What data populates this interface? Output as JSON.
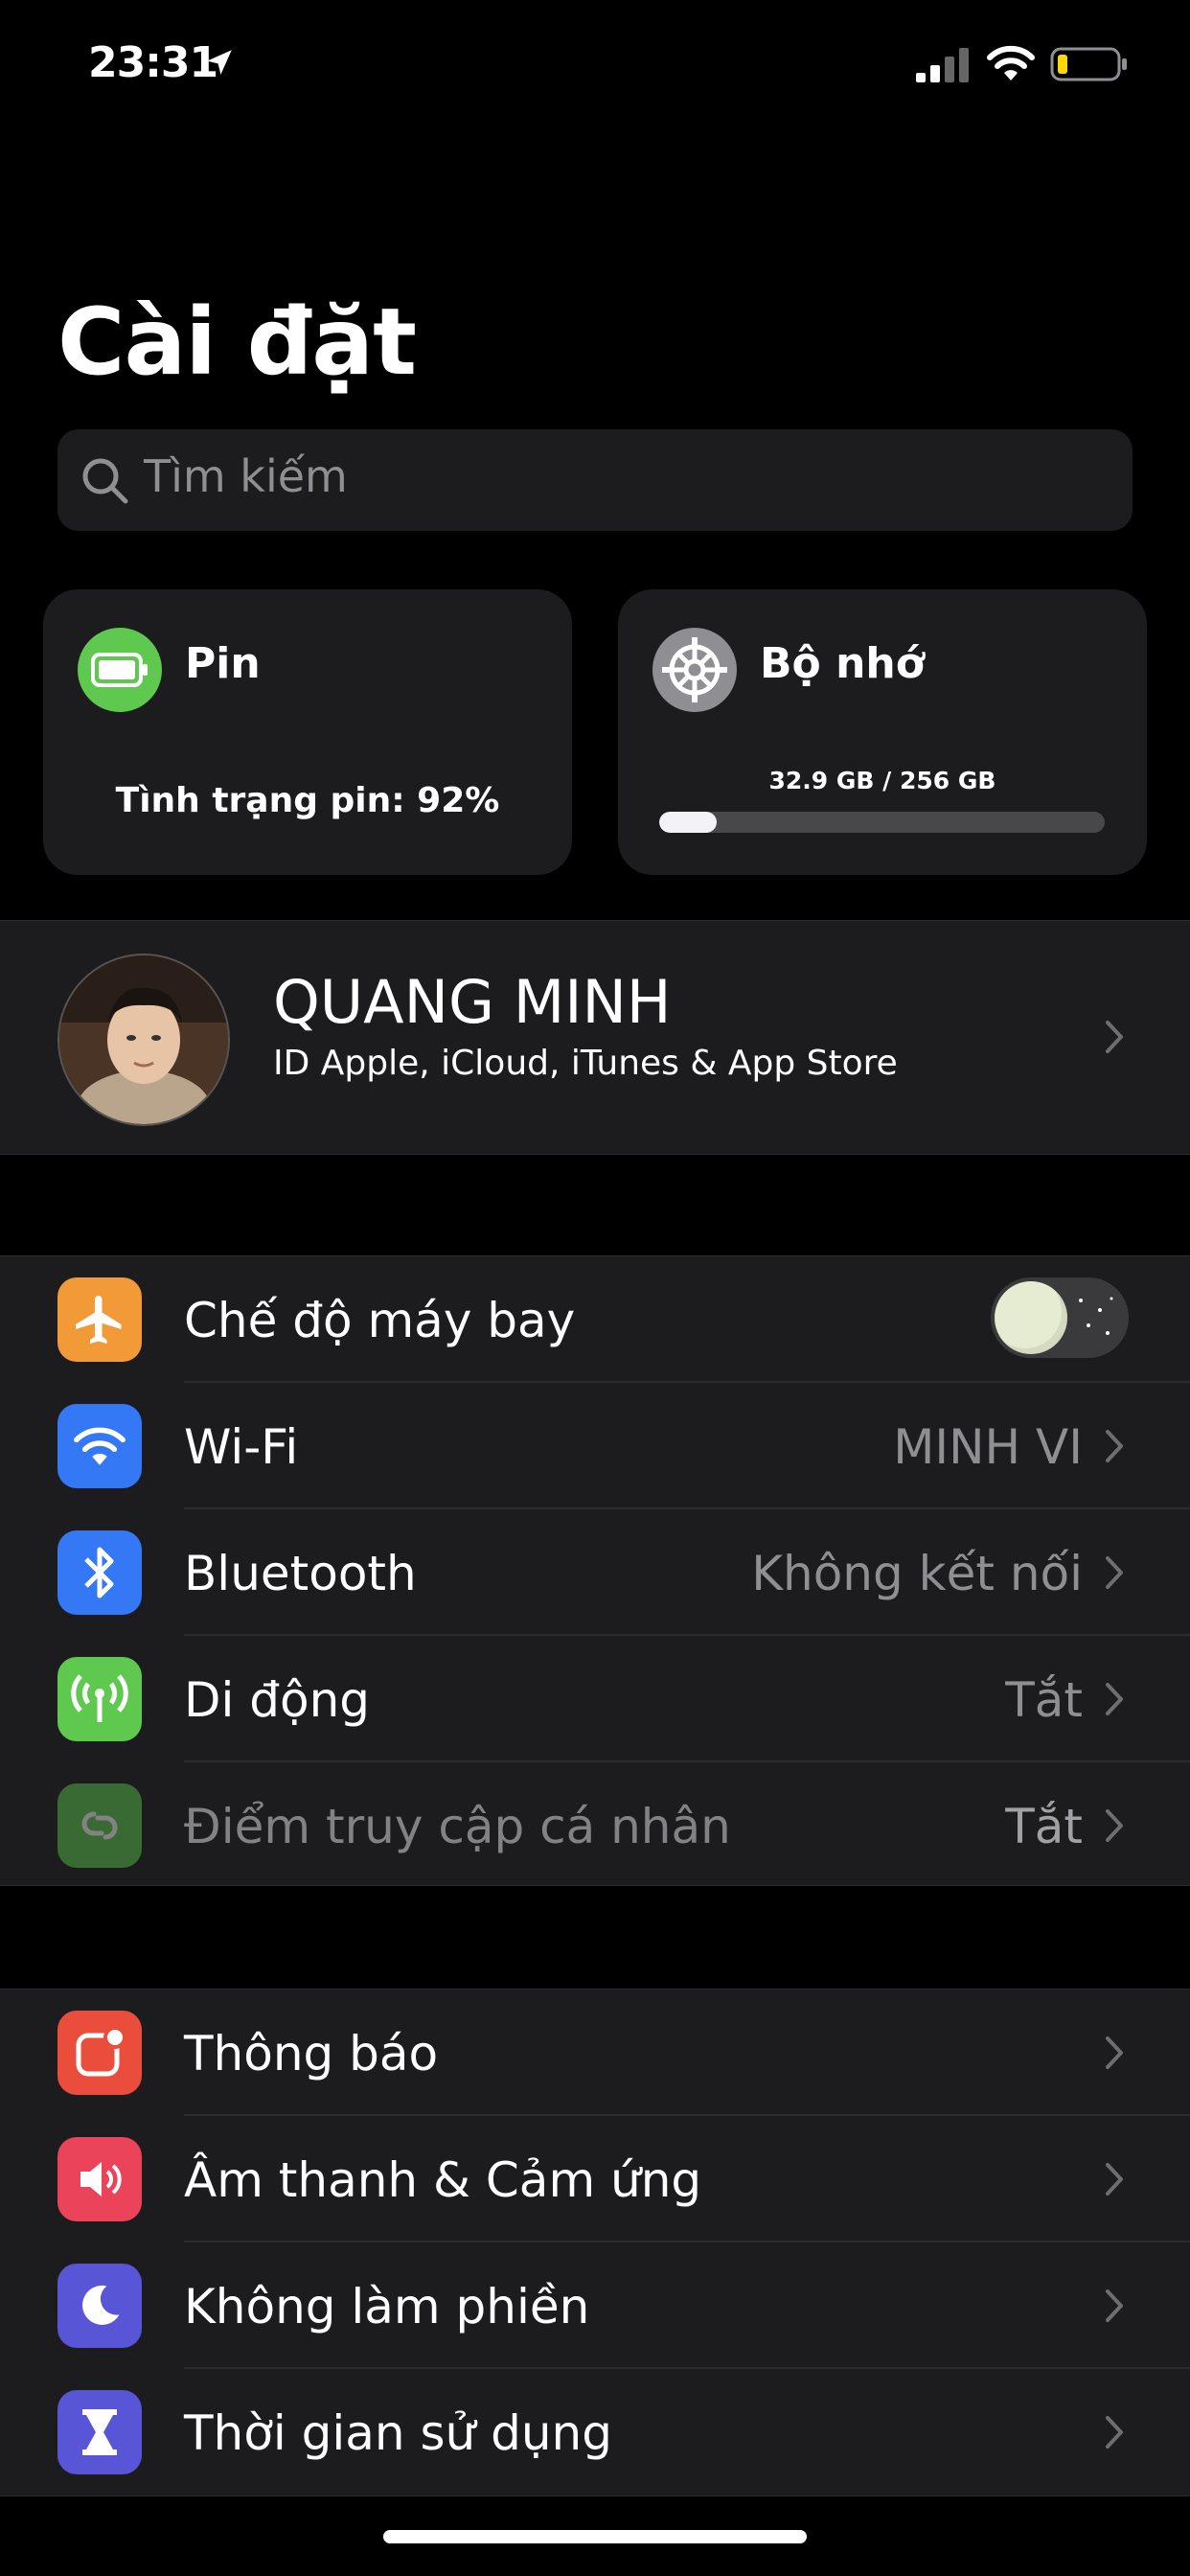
{
  "status_bar": {
    "time": "23:31",
    "icons": [
      "location-arrow-icon",
      "cellular-signal-icon",
      "wifi-icon",
      "battery-low-icon"
    ]
  },
  "header": {
    "title": "Cài đặt"
  },
  "search": {
    "placeholder": "Tìm kiếm",
    "icon": "search-icon"
  },
  "widgets": {
    "battery": {
      "title": "Pin",
      "health_text": "Tình trạng pin: 92%",
      "accent": "#5fc94f"
    },
    "storage": {
      "title": "Bộ nhớ",
      "usage_text": "32.9 GB / 256 GB",
      "used_fraction": 0.1285
    }
  },
  "profile": {
    "name": "QUANG MINH",
    "subtitle": "ID Apple, iCloud, iTunes & App Store"
  },
  "sections": [
    {
      "rows": [
        {
          "label": "Chế độ máy bay",
          "icon": "airplane-icon",
          "color": "#f19a37",
          "control": "toggle",
          "toggle_on": false
        },
        {
          "label": "Wi-Fi",
          "icon": "wifi-icon",
          "color": "#3478f6",
          "value": "MINH VI"
        },
        {
          "label": "Bluetooth",
          "icon": "bluetooth-icon",
          "color": "#3478f6",
          "value": "Không kết nối"
        },
        {
          "label": "Di động",
          "icon": "antenna-icon",
          "color": "#5fc94f",
          "value": "Tắt"
        },
        {
          "label": "Điểm truy cập cá nhân",
          "icon": "hotspot-icon",
          "color": "#5fc94f",
          "value": "Tắt",
          "disabled": true
        }
      ]
    },
    {
      "rows": [
        {
          "label": "Thông báo",
          "icon": "notification-icon",
          "color": "#eb4d3d"
        },
        {
          "label": "Âm thanh & Cảm ứng",
          "icon": "speaker-icon",
          "color": "#eb445a"
        },
        {
          "label": "Không làm phiền",
          "icon": "moon-icon",
          "color": "#5856d6"
        },
        {
          "label": "Thời gian sử dụng",
          "icon": "hourglass-icon",
          "color": "#5856d6"
        }
      ]
    }
  ]
}
